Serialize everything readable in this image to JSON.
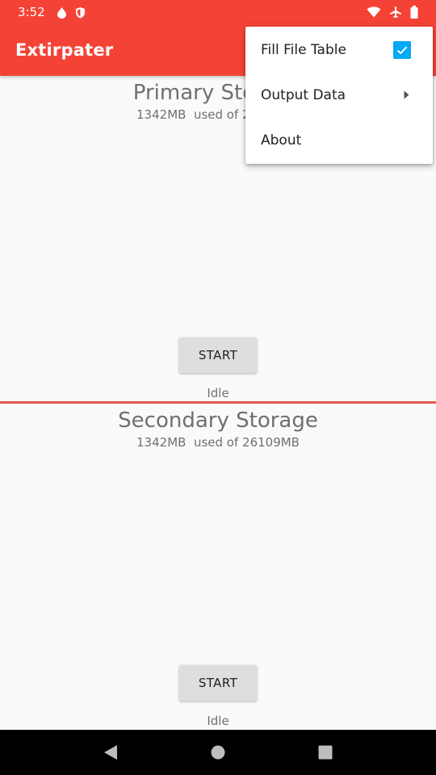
{
  "status_bar": {
    "time": "3:52",
    "left_icons": [
      "drop-icon",
      "shield-icon"
    ],
    "right_icons": [
      "wifi-icon",
      "airplane-icon",
      "battery-icon"
    ]
  },
  "app_bar": {
    "title": "Extirpater",
    "color": "#f44336"
  },
  "primary": {
    "title": "Primary Storage",
    "usage": "1342MB  used of 26109MB",
    "button_label": "START",
    "status": "Idle"
  },
  "secondary": {
    "title": "Secondary Storage",
    "usage": "1342MB  used of 26109MB",
    "button_label": "START",
    "status": "Idle"
  },
  "menu": {
    "items": [
      {
        "label": "Fill File Table",
        "checked": true
      },
      {
        "label": "Output Data",
        "has_submenu": true
      },
      {
        "label": "About"
      }
    ],
    "checkbox_color": "#03a9f4"
  },
  "nav_bar": {
    "icons": [
      "back-icon",
      "home-icon",
      "recents-icon"
    ]
  }
}
